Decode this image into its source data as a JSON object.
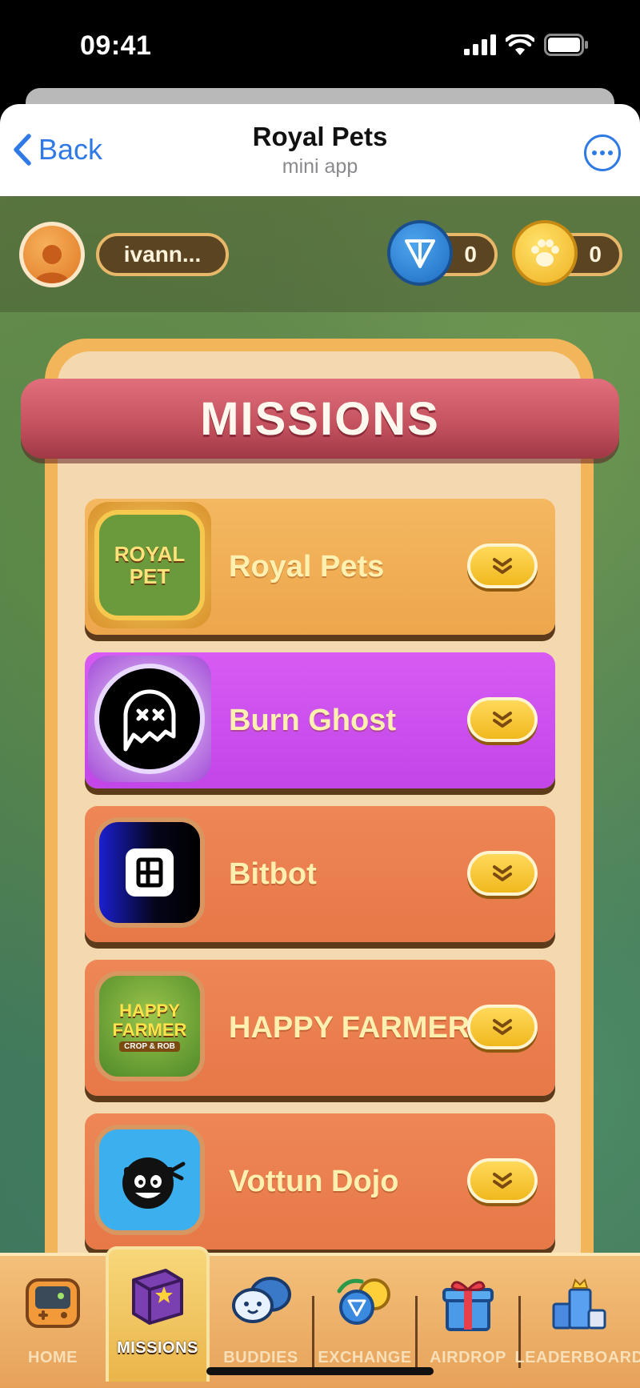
{
  "status_bar": {
    "time": "09:41"
  },
  "header": {
    "back_label": "Back",
    "title": "Royal Pets",
    "subtitle": "mini app"
  },
  "topbar": {
    "username": "ivann...",
    "ton_balance": "0",
    "paw_balance": "0"
  },
  "missions": {
    "title": "MISSIONS",
    "items": [
      {
        "name": "Royal Pets",
        "theme": "gold",
        "thumb_text": "ROYAL PET"
      },
      {
        "name": "Burn Ghost",
        "theme": "purple"
      },
      {
        "name": "Bitbot",
        "theme": "orange"
      },
      {
        "name": "HAPPY FARMER",
        "theme": "orange",
        "thumb_text": "HAPPY FARMER",
        "thumb_subtext": "CROP & ROB"
      },
      {
        "name": "Vottun Dojo",
        "theme": "orange"
      }
    ]
  },
  "nav": {
    "items": [
      {
        "label": "HOME",
        "icon": "console-icon"
      },
      {
        "label": "MISSIONS",
        "icon": "book-icon",
        "active": true
      },
      {
        "label": "BUDDIES",
        "icon": "buddies-icon"
      },
      {
        "label": "EXCHANGE",
        "icon": "exchange-icon"
      },
      {
        "label": "AIRDROP",
        "icon": "gift-icon"
      },
      {
        "label": "LEADERBOARD",
        "icon": "trophy-icon"
      }
    ]
  },
  "colors": {
    "accent_blue": "#2f7ae5",
    "banner_red": "#c3505d",
    "mission_gold": "#eda64c",
    "mission_purple": "#c246e8",
    "mission_orange": "#e77848",
    "button_yellow": "#f0b81e"
  }
}
